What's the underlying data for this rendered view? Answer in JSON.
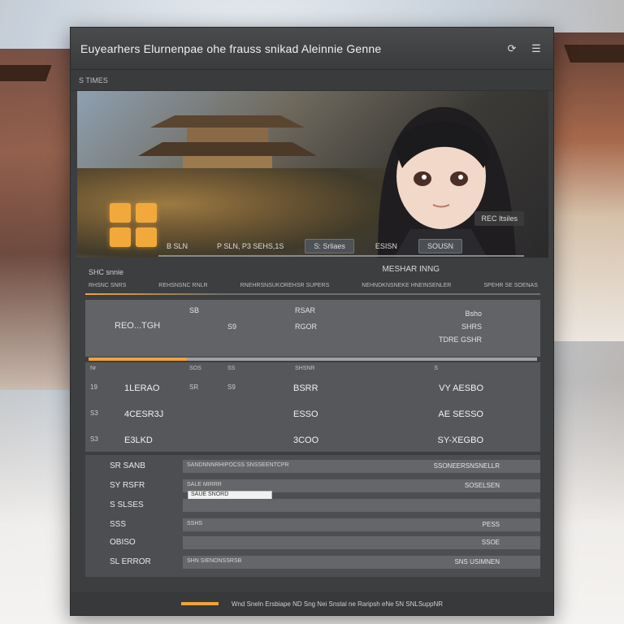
{
  "window": {
    "title": "Euyearhers Elurnenpae ohe frauss snikad Aleinnie Genne",
    "subtitle": "S TIMES",
    "controls": {
      "refresh": "⟳",
      "menu": "☰"
    }
  },
  "hero": {
    "badge": "REC Itsiles",
    "pills": [
      "B  SLN",
      "P SLN, P3 SEHS,1S",
      "S: Srliaes",
      "ESISN",
      "SOUSN"
    ]
  },
  "section": {
    "left_title": "SHC snnie",
    "right_title": "MESHAR INNG",
    "columns": [
      "RHSNC SNRS",
      "REHSNSNC RNLR",
      "RNEHRSNSUKOREHSR SUPERS",
      "NEHNDKNSNEKE HNEINSENLER",
      "SPEHR SE SOENAS"
    ]
  },
  "summary": {
    "label": "REO...TGH",
    "col2": "SB",
    "col2b": "S9",
    "col3": "RSAR",
    "col3b": "RGOR",
    "right_a": "Bsho",
    "right_b": "SHRS",
    "right_c": "TDRE GSHR"
  },
  "progress_pct": 22,
  "table": {
    "headers": [
      "Nr",
      "SOS",
      "SS",
      "SHSNR",
      "S"
    ],
    "rows": [
      {
        "n": "19",
        "name": "1LERAO",
        "a": "SR",
        "b": "S9",
        "value": "BSRR",
        "right": "VY AESBO"
      },
      {
        "n": "S3",
        "name": "4CESR3J",
        "a": "",
        "b": "",
        "value": "ESSO",
        "right": "AE SESSO"
      },
      {
        "n": "S3",
        "name": "E3LKD",
        "a": "",
        "b": "",
        "value": "3COO",
        "right": "SY-XEGBO"
      }
    ]
  },
  "lower": {
    "rows": [
      {
        "lbl": "SR SANB",
        "mid": "SANDNNNRHIPOCSS SNSSEENTCPR",
        "right": "SSONEERSNSNELLR"
      },
      {
        "lbl": "SY RSFR",
        "mid": "SALE MIRRR",
        "right": "SOSELSEN"
      },
      {
        "lbl": "S SLSES",
        "mid": "",
        "right": ""
      },
      {
        "lbl": "SSS",
        "mid": "SSHS",
        "right": "PESS"
      },
      {
        "lbl": "OBISO",
        "mid": "",
        "right": "SSOE"
      },
      {
        "lbl": "SL ERROR",
        "mid": "SHN SIENONSSRSB",
        "right": "SNS USIMNEN"
      }
    ],
    "input_value": "SAUE SNORD"
  },
  "footer": {
    "text": "Wnd Sneln Ersbiape ND Sng Nei Snstal ne Raripsh eNe 5N SNLSuppNR"
  }
}
